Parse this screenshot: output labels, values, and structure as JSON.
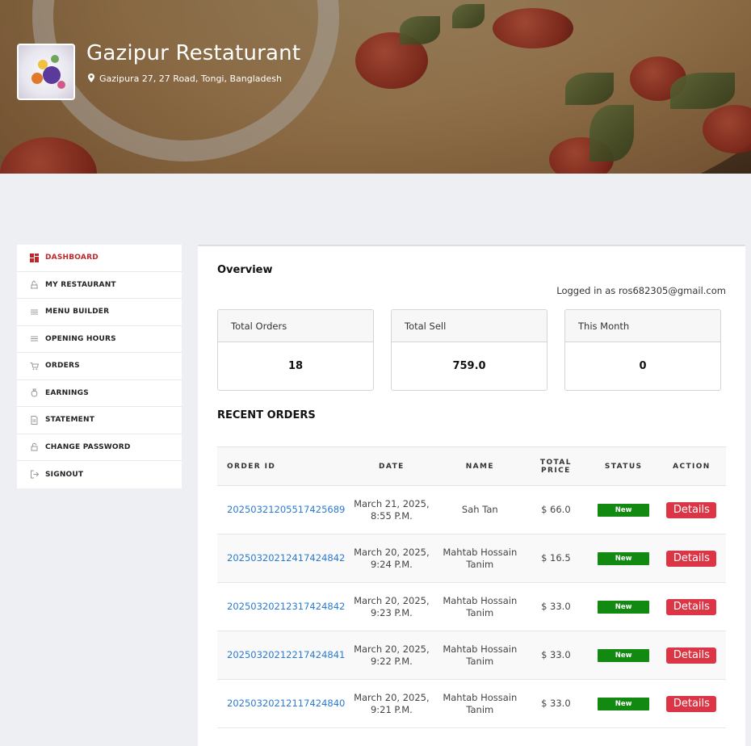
{
  "header": {
    "restaurant_name": "Gazipur Restaturant",
    "address": "Gazipura 27, 27 Road, Tongi, Bangladesh"
  },
  "sidebar": {
    "items": [
      {
        "label": "DASHBOARD",
        "icon": "dashboard-icon",
        "active": true
      },
      {
        "label": "MY RESTAURANT",
        "icon": "restaurant-icon",
        "active": false
      },
      {
        "label": "MENU BUILDER",
        "icon": "menu-lines-icon",
        "active": false
      },
      {
        "label": "OPENING HOURS",
        "icon": "clock-lines-icon",
        "active": false
      },
      {
        "label": "ORDERS",
        "icon": "cart-icon",
        "active": false
      },
      {
        "label": "EARNINGS",
        "icon": "money-bag-icon",
        "active": false
      },
      {
        "label": "STATEMENT",
        "icon": "document-icon",
        "active": false
      },
      {
        "label": "CHANGE PASSWORD",
        "icon": "lock-icon",
        "active": false
      },
      {
        "label": "SIGNOUT",
        "icon": "signout-icon",
        "active": false
      }
    ]
  },
  "overview": {
    "title": "Overview",
    "logged_in": "Logged in as ros682305@gmail.com",
    "cards": [
      {
        "label": "Total Orders",
        "value": "18"
      },
      {
        "label": "Total Sell",
        "value": "759.0"
      },
      {
        "label": "This Month",
        "value": "0"
      }
    ]
  },
  "recent_orders": {
    "title": "RECENT ORDERS",
    "columns": {
      "order_id": "ORDER ID",
      "date": "DATE",
      "name": "NAME",
      "total_price_1": "TOTAL",
      "total_price_2": "PRICE",
      "status": "STATUS",
      "action": "ACTION"
    },
    "rows": [
      {
        "id": "20250321205517425689",
        "date_1": "March 21, 2025,",
        "date_2": "8:55 P.M.",
        "name_1": "Sah Tan",
        "name_2": "",
        "price": "$ 66.0",
        "status": "New",
        "action": "Details"
      },
      {
        "id": "20250320212417424842",
        "date_1": "March 20, 2025,",
        "date_2": "9:24 P.M.",
        "name_1": "Mahtab Hossain",
        "name_2": "Tanim",
        "price": "$ 16.5",
        "status": "New",
        "action": "Details"
      },
      {
        "id": "20250320212317424842",
        "date_1": "March 20, 2025,",
        "date_2": "9:23 P.M.",
        "name_1": "Mahtab Hossain",
        "name_2": "Tanim",
        "price": "$ 33.0",
        "status": "New",
        "action": "Details"
      },
      {
        "id": "20250320212217424841",
        "date_1": "March 20, 2025,",
        "date_2": "9:22 P.M.",
        "name_1": "Mahtab Hossain",
        "name_2": "Tanim",
        "price": "$ 33.0",
        "status": "New",
        "action": "Details"
      },
      {
        "id": "20250320212117424840",
        "date_1": "March 20, 2025,",
        "date_2": "9:21 P.M.",
        "name_1": "Mahtab Hossain",
        "name_2": "Tanim",
        "price": "$ 33.0",
        "status": "New",
        "action": "Details"
      }
    ]
  },
  "colors": {
    "accent_red": "#c0272d",
    "link_blue": "#2a7bd1",
    "status_green": "#128a12",
    "button_red": "#dc3545"
  }
}
